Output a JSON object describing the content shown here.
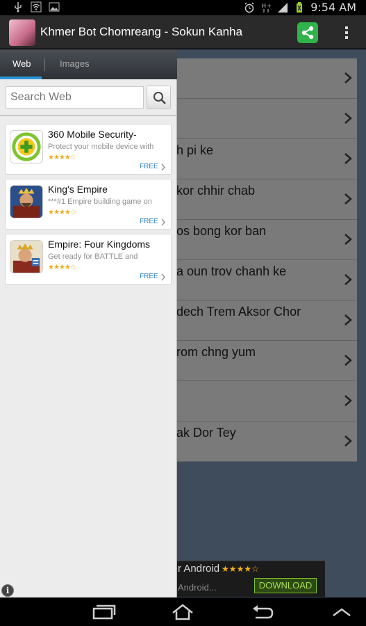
{
  "status_bar": {
    "time": "9:54 AM",
    "icons": [
      "usb-icon",
      "wifi-hotspot-icon",
      "image-notification-icon",
      "alarm-icon",
      "hplus-data-icon",
      "signal-icon",
      "battery-icon"
    ]
  },
  "app_bar": {
    "title": "Khmer Bot Chomreang - Sokun Kanha",
    "share_icon": "share-icon",
    "menu_icon": "overflow-menu-icon",
    "share_color": "#2fb34a"
  },
  "background_list": {
    "rows": [
      {
        "text": ""
      },
      {
        "text": ""
      },
      {
        "text": "h pi ke"
      },
      {
        "text": "kor chhir chab"
      },
      {
        "text": "os bong kor ban"
      },
      {
        "text": "a oun trov chanh ke"
      },
      {
        "text": "dech Trem Aksor Chor"
      },
      {
        "text": "rom chng yum"
      },
      {
        "text": ""
      },
      {
        "text": "ak Dor Tey"
      }
    ]
  },
  "ad_banner": {
    "line1": "r Android",
    "stars": "★★★★☆",
    "line2": "Android...",
    "download_label": "DOWNLOAD"
  },
  "drawer": {
    "tabs": [
      {
        "label": "Web",
        "active": true
      },
      {
        "label": "Images",
        "active": false
      }
    ],
    "search": {
      "placeholder": "Search Web",
      "value": ""
    },
    "accent_color": "#2a95d6",
    "apps": [
      {
        "title": "360 Mobile Security-",
        "desc": "Protect your mobile device with",
        "stars": "★★★★☆",
        "price": "FREE",
        "icon": "360-security-app-icon"
      },
      {
        "title": "King's Empire",
        "desc": "***#1 Empire building game on",
        "stars": "★★★★☆",
        "price": "FREE",
        "icon": "kings-empire-app-icon"
      },
      {
        "title": "Empire: Four Kingdoms",
        "desc": "Get ready for BATTLE and",
        "stars": "★★★★☆",
        "price": "FREE",
        "icon": "empire-four-kingdoms-app-icon"
      }
    ],
    "info_glyph": "i"
  },
  "nav_bar": {
    "buttons": [
      "recent-apps-icon",
      "home-icon",
      "back-icon",
      "collapse-icon"
    ]
  }
}
